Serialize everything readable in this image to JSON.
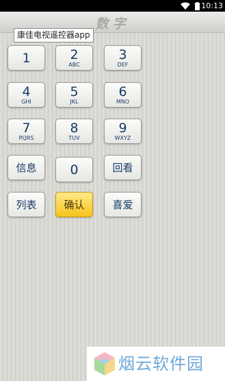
{
  "status": {
    "time": "10:13",
    "wifi_icon": "wifi-icon",
    "battery_icon": "battery-icon"
  },
  "header": {
    "title": "数字"
  },
  "tooltip": {
    "text": "康佳电视遥控器app"
  },
  "keypad": {
    "keys": [
      {
        "digit": "1",
        "letters": ""
      },
      {
        "digit": "2",
        "letters": "ABC"
      },
      {
        "digit": "3",
        "letters": "DEF"
      },
      {
        "digit": "4",
        "letters": "GHI"
      },
      {
        "digit": "5",
        "letters": "JKL"
      },
      {
        "digit": "6",
        "letters": "MNO"
      },
      {
        "digit": "7",
        "letters": "PQRS"
      },
      {
        "digit": "8",
        "letters": "TUV"
      },
      {
        "digit": "9",
        "letters": "WXYZ"
      },
      {
        "label": "信息"
      },
      {
        "digit": "0",
        "letters": ""
      },
      {
        "label": "回看"
      },
      {
        "label": "列表"
      },
      {
        "label": "确认"
      },
      {
        "label": "喜爱"
      }
    ]
  },
  "watermark": {
    "text": "烟云软件园"
  },
  "colors": {
    "accent": "#f7c21c",
    "key_text": "#163b67",
    "watermark": "#6fa7d8"
  }
}
